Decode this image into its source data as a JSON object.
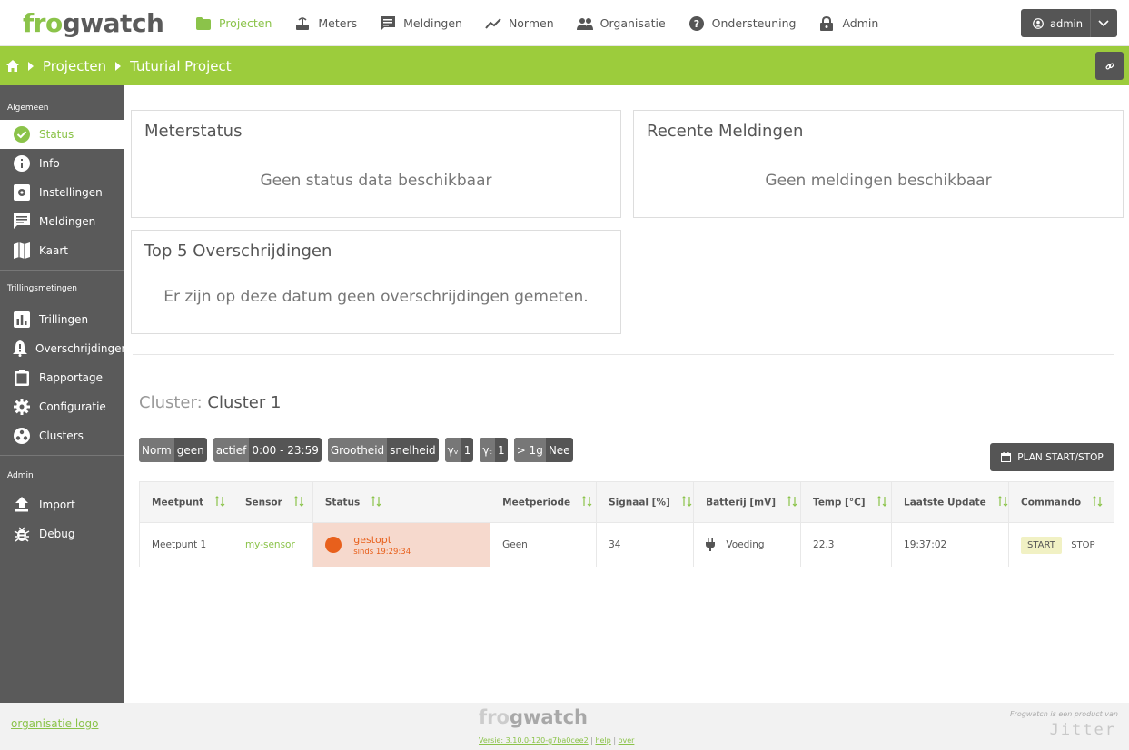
{
  "brand": {
    "logo_prefix": "fr",
    "logo_suffix": "gwatch",
    "logo_o": "o"
  },
  "nav": {
    "items": [
      {
        "label": "Projecten",
        "icon": "folder-icon"
      },
      {
        "label": "Meters",
        "icon": "router-icon"
      },
      {
        "label": "Meldingen",
        "icon": "message-icon"
      },
      {
        "label": "Normen",
        "icon": "trend-icon"
      },
      {
        "label": "Organisatie",
        "icon": "people-icon"
      },
      {
        "label": "Ondersteuning",
        "icon": "help-icon"
      },
      {
        "label": "Admin",
        "icon": "lock-icon"
      }
    ],
    "active": "Projecten",
    "user_label": "admin"
  },
  "breadcrumb": {
    "section": "Projecten",
    "current": "Tuturial Project"
  },
  "sidebar": {
    "sections": [
      {
        "title": "Algemeen",
        "items": [
          "Status",
          "Info",
          "Instellingen",
          "Meldingen",
          "Kaart"
        ]
      },
      {
        "title": "Trillingsmetingen",
        "items": [
          "Trillingen",
          "Overschrijdingen",
          "Rapportage",
          "Configuratie",
          "Clusters"
        ]
      },
      {
        "title": "Admin",
        "items": [
          "Import",
          "Debug"
        ]
      }
    ],
    "active": "Status"
  },
  "cards": {
    "meterstatus": {
      "title": "Meterstatus",
      "empty": "Geen status data beschikbaar"
    },
    "recent": {
      "title": "Recente Meldingen",
      "empty": "Geen meldingen beschikbaar"
    },
    "top5": {
      "title": "Top 5 Overschrijdingen",
      "empty": "Er zijn op deze datum geen overschrijdingen gemeten."
    }
  },
  "cluster": {
    "label": "Cluster:",
    "name": "Cluster 1",
    "tags": [
      {
        "k": "Norm",
        "v": "geen"
      },
      {
        "k": "actief",
        "v": "0:00 - 23:59"
      },
      {
        "k": "Grootheid",
        "v": "snelheid"
      },
      {
        "k": "γᵥ",
        "v": "1"
      },
      {
        "k": "γₜ",
        "v": "1"
      },
      {
        "k": "> 1g",
        "v": "Nee"
      }
    ],
    "plan_button": "PLAN START/STOP"
  },
  "table": {
    "headers": [
      "Meetpunt",
      "Sensor",
      "Status",
      "Meetperiode",
      "Signaal [%]",
      "Batterij [mV]",
      "Temp [°C]",
      "Laatste Update",
      "Commando"
    ],
    "row": {
      "meetpunt": "Meetpunt 1",
      "sensor": "my-sensor",
      "status": "gestopt",
      "status_since": "sinds 19:29:34",
      "meetperiode": "Geen",
      "signaal": "34",
      "batterij": "Voeding",
      "temp": "22,3",
      "update": "19:37:02",
      "cmd_start": "START",
      "cmd_stop": "STOP"
    }
  },
  "footer": {
    "org_logo": "organisatie logo",
    "version": "Versie: 3.10.0-120-g7ba0cee2",
    "help": "help",
    "over": "over",
    "product_of": "Frogwatch is een product van",
    "jitter": "Jitter"
  },
  "colors": {
    "accent": "#9ccc3c",
    "dark": "#555555",
    "status_stopped": "#e8601c"
  }
}
